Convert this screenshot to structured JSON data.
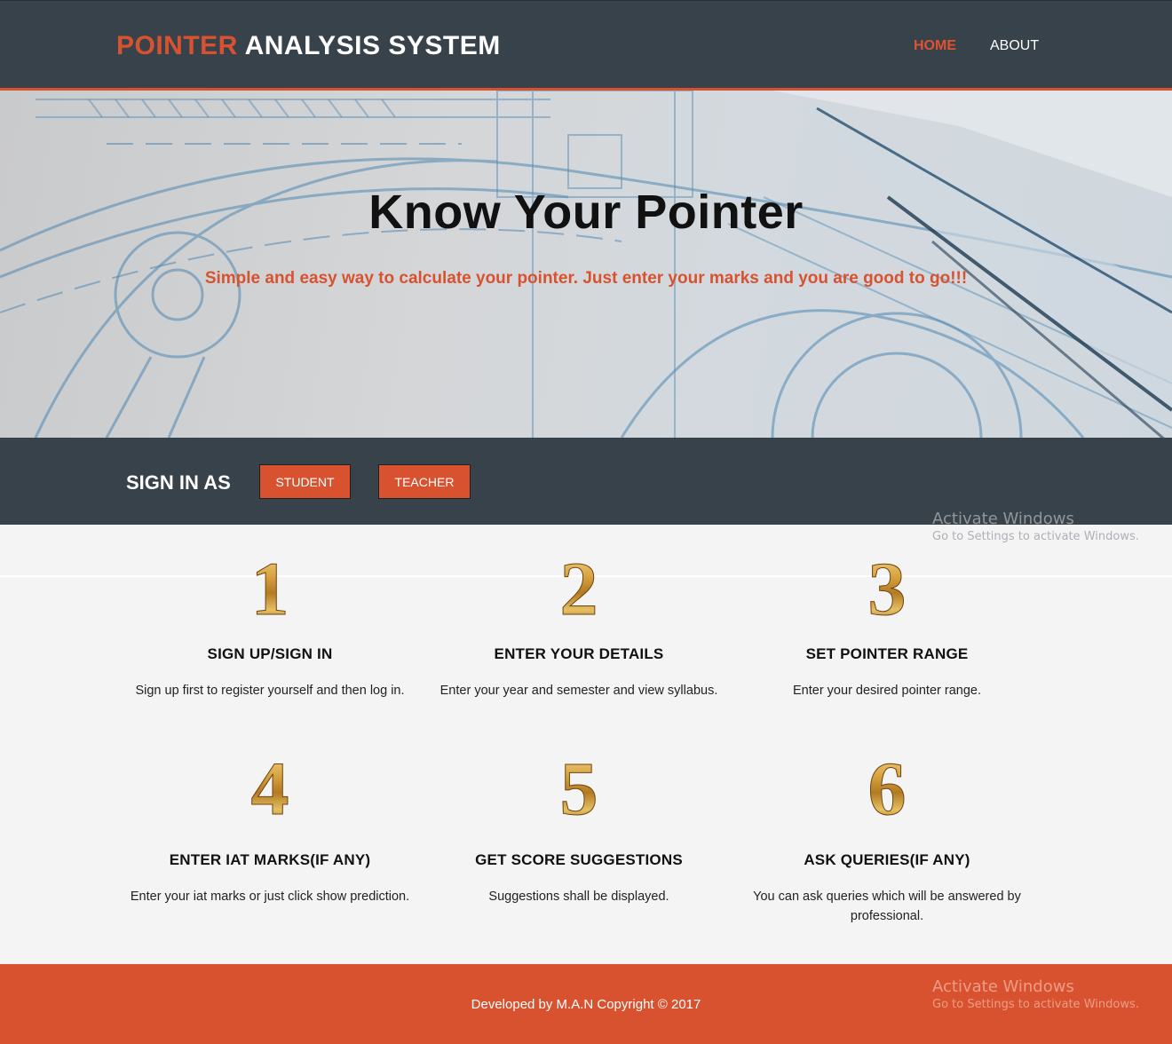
{
  "header": {
    "brand_accent": "POINTER",
    "brand_main": "ANALYSIS SYSTEM",
    "nav": [
      {
        "label": "HOME",
        "active": true
      },
      {
        "label": "ABOUT",
        "active": false
      }
    ]
  },
  "hero": {
    "title": "Know Your Pointer",
    "subtitle": "Simple and easy way to calculate your pointer. Just enter your marks and you are good to go!!!"
  },
  "signin": {
    "label": "SIGN IN AS",
    "student_button": "STUDENT",
    "teacher_button": "TEACHER"
  },
  "steps": [
    {
      "number": "1",
      "title": "SIGN UP/SIGN IN",
      "description": "Sign up first to register yourself and then log in."
    },
    {
      "number": "2",
      "title": "ENTER YOUR DETAILS",
      "description": "Enter your year and semester and view syllabus."
    },
    {
      "number": "3",
      "title": "SET POINTER RANGE",
      "description": "Enter your desired pointer range."
    },
    {
      "number": "4",
      "title": "ENTER IAT MARKS(IF ANY)",
      "description": "Enter your iat marks or just click show prediction."
    },
    {
      "number": "5",
      "title": "GET SCORE SUGGESTIONS",
      "description": "Suggestions shall be displayed."
    },
    {
      "number": "6",
      "title": "ASK QUERIES(IF ANY)",
      "description": "You can ask queries which will be answered by professional."
    }
  ],
  "footer": {
    "text": "Developed by M.A.N Copyright © 2017"
  },
  "watermark": {
    "title": "Activate Windows",
    "subtitle": "Go to Settings to activate Windows."
  },
  "colors": {
    "accent": "#d9522f",
    "dark": "#37424a",
    "gold_light": "#f3d27a",
    "gold_dark": "#8a5a14"
  }
}
